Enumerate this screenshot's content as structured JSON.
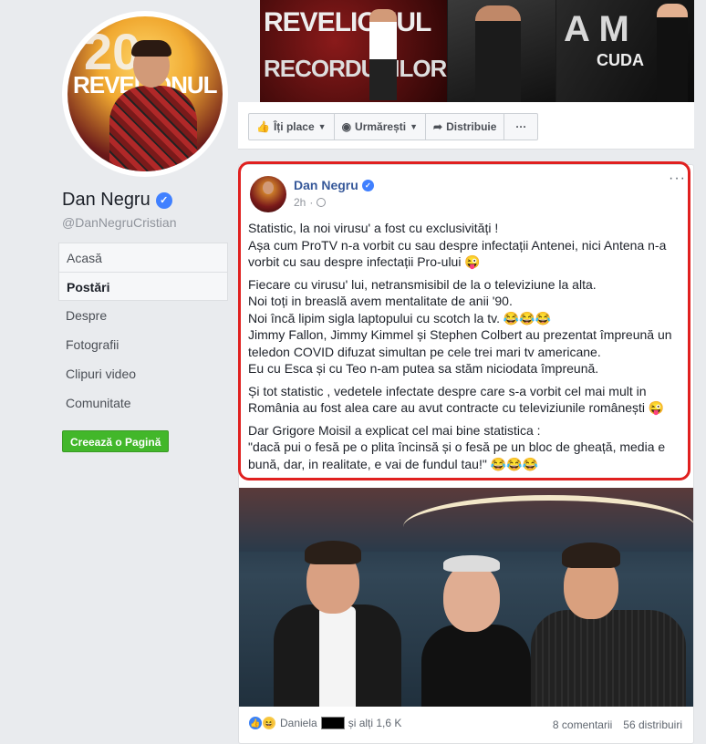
{
  "page": {
    "name": "Dan Negru",
    "handle": "@DanNegruCristian",
    "verified_mark": "✓"
  },
  "nav": {
    "items": [
      "Acasă",
      "Postări",
      "Despre",
      "Fotografii",
      "Clipuri video",
      "Comunitate"
    ],
    "active_index": 1
  },
  "create_page_label": "Creează o Pagină",
  "cover_strip": {
    "left_text_1": "REVELIONUL",
    "left_text_2": "RECORDURILOR",
    "right_text_1": "A M",
    "right_text_2": "CUDA"
  },
  "avatar_overlay": {
    "number": "20",
    "text": "REVELIONUL"
  },
  "action_bar": {
    "like": "Îți place",
    "follow": "Urmărești",
    "share": "Distribuie",
    "more": "···"
  },
  "post": {
    "author": "Dan Negru",
    "time": "2h",
    "separator": "·",
    "more": "···",
    "paragraphs": [
      [
        "Statistic, la noi virusu' a fost cu exclusivități !",
        "Așa cum ProTV n-a vorbit cu sau despre infectații Antenei, nici Antena n-a vorbit cu sau despre infectații Pro-ului 😜"
      ],
      [
        "Fiecare cu virusu' lui, netransmisibil de la o televiziune la alta.",
        "Noi toți in breaslă avem mentalitate de anii '90.",
        "Noi încă lipim sigla laptopului cu scotch la tv. 😂😂😂",
        "Jimmy Fallon, Jimmy Kimmel și Stephen Colbert au prezentat împreună un teledon COVID difuzat simultan pe cele trei mari tv americane.",
        "Eu cu Esca și cu Teo n-am putea sa stăm niciodata împreună."
      ],
      [
        "Și tot statistic , vedetele infectate despre care s-a vorbit cel mai mult in România au fost alea care au avut contracte cu televiziunile românești 😜"
      ],
      [
        "Dar Grigore Moisil a explicat cel mai bine statistica :",
        "\"dacă pui o fesă pe o plita încinsă și o fesă pe un bloc de gheață, media e bună, dar, in realitate, e vai de fundul tau!\" 😂😂😂"
      ]
    ],
    "reactions": {
      "like_icon": "👍",
      "haha_icon": "😆",
      "name": "Daniela",
      "others": "și alți 1,6 K"
    },
    "comments": "8 comentarii",
    "shares": "56 distribuiri"
  },
  "colors": {
    "link": "#365899",
    "verified": "#4080ff",
    "create_button": "#42b72a",
    "highlight": "#e0201f"
  }
}
